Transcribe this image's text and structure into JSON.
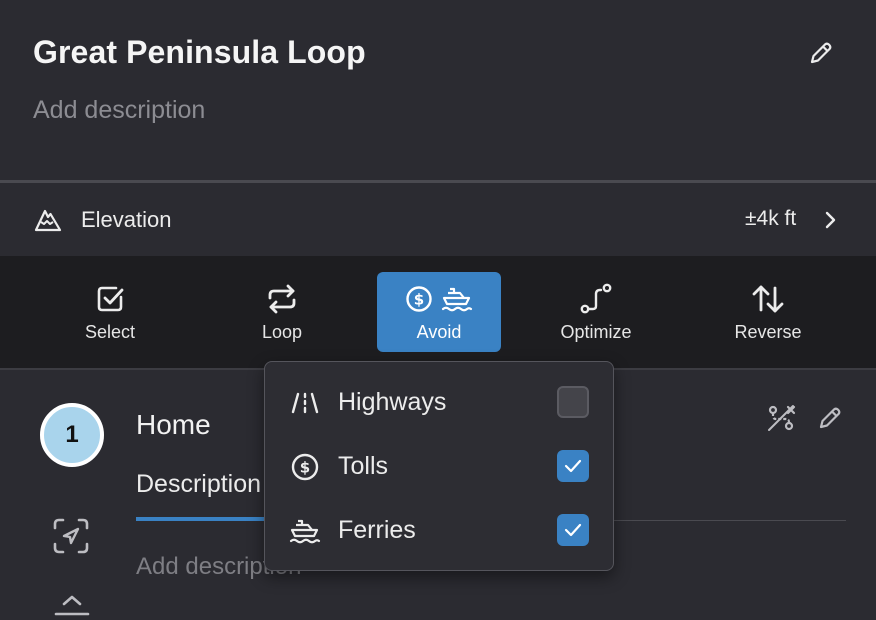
{
  "route": {
    "title": "Great Peninsula Loop",
    "description_placeholder": "Add description"
  },
  "elevation": {
    "label": "Elevation",
    "value": "±4k ft"
  },
  "toolbar": {
    "select_label": "Select",
    "loop_label": "Loop",
    "avoid_label": "Avoid",
    "optimize_label": "Optimize",
    "reverse_label": "Reverse",
    "active": "Avoid",
    "accent_color": "#3a82c4"
  },
  "avoid_menu": {
    "items": [
      {
        "label": "Highways",
        "icon": "highway-icon",
        "checked": false
      },
      {
        "label": "Tolls",
        "icon": "toll-icon",
        "checked": true
      },
      {
        "label": "Ferries",
        "icon": "ferry-icon",
        "checked": true
      }
    ]
  },
  "waypoint": {
    "number": "1",
    "name": "Home",
    "tab_label": "Description",
    "description_placeholder": "Add description",
    "badge_color": "#a9d4ec"
  }
}
